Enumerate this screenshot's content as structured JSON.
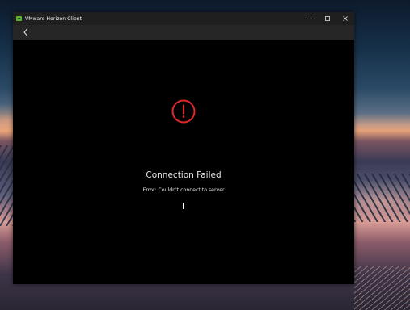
{
  "window": {
    "title": "VMware Horizon Client",
    "icon": "vmware-horizon-icon",
    "controls": [
      "minimize-icon",
      "maximize-icon",
      "close-icon"
    ]
  },
  "nav": {
    "back_icon": "chevron-left-icon"
  },
  "error": {
    "icon": "alert-circle-icon",
    "icon_color": "#e02828",
    "heading": "Connection Failed",
    "message": "Error: Couldn't connect to server"
  },
  "colors": {
    "titlebar": "#1f1f1f",
    "navbar": "#262626",
    "window_bg": "#000000"
  }
}
